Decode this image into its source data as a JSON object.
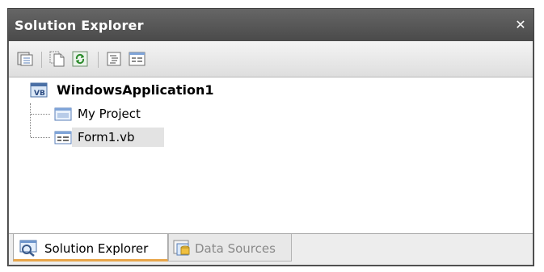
{
  "window": {
    "title": "Solution Explorer",
    "close_glyph": "✕"
  },
  "toolbar": {
    "buttons": [
      {
        "name": "properties-icon"
      },
      {
        "name": "show-all-files-icon"
      },
      {
        "name": "refresh-icon"
      },
      {
        "name": "view-code-icon"
      },
      {
        "name": "view-designer-icon"
      }
    ]
  },
  "tree": {
    "root": {
      "label": "WindowsApplication1",
      "icon": "vb-project-icon"
    },
    "children": [
      {
        "label": "My Project",
        "icon": "my-project-icon"
      },
      {
        "label": "Form1.vb",
        "icon": "form-icon",
        "selected": true
      }
    ]
  },
  "tabs": [
    {
      "label": "Solution Explorer",
      "icon": "solution-explorer-icon",
      "active": true
    },
    {
      "label": "Data Sources",
      "icon": "data-sources-icon",
      "active": false
    }
  ],
  "colors": {
    "titlebar": "#555555",
    "tab_accent": "#e8a64a",
    "selection": "#e3e3e3"
  }
}
